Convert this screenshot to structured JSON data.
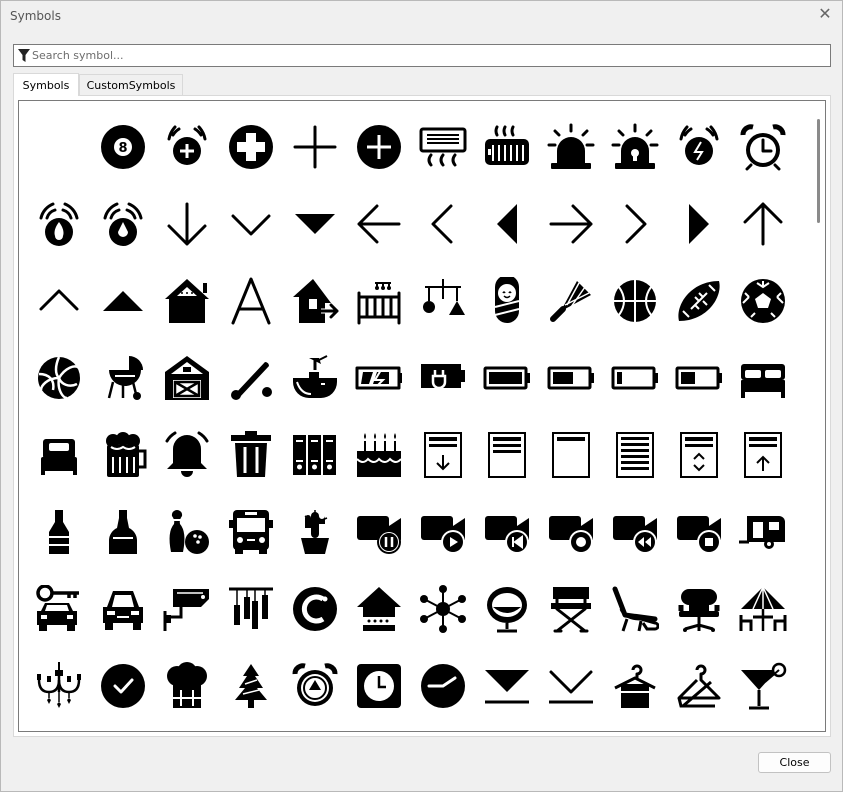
{
  "window": {
    "title": "Symbols",
    "close_glyph": "✕"
  },
  "search": {
    "placeholder": "Search symbol...",
    "value": "",
    "icon": "filter-icon"
  },
  "tabs": [
    {
      "label": "Symbols",
      "active": true
    },
    {
      "label": "CustomSymbols",
      "active": false
    }
  ],
  "symbols": [
    [
      "blank",
      "8-ball",
      "add-alarm",
      "add-circle",
      "add",
      "add-circle-solid",
      "air-conditioner",
      "heater",
      "alarm-siren",
      "alarm-light",
      "alarm-ringing",
      "alarm-clock"
    ],
    [
      "fire-alarm",
      "water-alarm",
      "arrow-down",
      "chevron-down",
      "triangle-down",
      "arrow-left",
      "chevron-left",
      "triangle-left",
      "arrow-right",
      "chevron-right",
      "triangle-right",
      "arrow-up"
    ],
    [
      "chevron-up",
      "triangle-up",
      "attic",
      "letter-a",
      "away-home",
      "baby-crib",
      "baby-mobile",
      "baby",
      "badminton",
      "basketball",
      "american-football",
      "soccer-ball"
    ],
    [
      "volleyball",
      "barbecue",
      "barn",
      "baseball",
      "bathtub",
      "battery-charging",
      "battery-plug",
      "battery-full",
      "battery-high",
      "battery-low",
      "battery-medium",
      "bed"
    ],
    [
      "bed-single",
      "beer",
      "bell-ringing",
      "trash-bin",
      "binders",
      "birthday-cake",
      "document-download",
      "document-lines",
      "document-blank",
      "document-full",
      "document-collapse",
      "document-upload"
    ],
    [
      "bottle",
      "bottle-round",
      "bowling",
      "bus",
      "cactus",
      "camera-pause",
      "camera-play",
      "camera-previous",
      "camera-record",
      "camera-rewind",
      "camera-stop",
      "camper-trailer"
    ],
    [
      "car-key",
      "car",
      "security-camera",
      "wind-chimes",
      "ccleaner",
      "home-router",
      "molecule",
      "egg-chair",
      "directors-chair",
      "lounge-chair",
      "patio-chair",
      "parasol-table"
    ],
    [
      "chandelier",
      "check-circle",
      "chef-hat",
      "christmas-tree",
      "alarm-recycle",
      "clock-square",
      "clock-circle",
      "collapse-down",
      "chevron-down-line",
      "towel-hanger",
      "coat-hanger",
      "cocktail"
    ]
  ],
  "close_button": {
    "label": "Close"
  }
}
